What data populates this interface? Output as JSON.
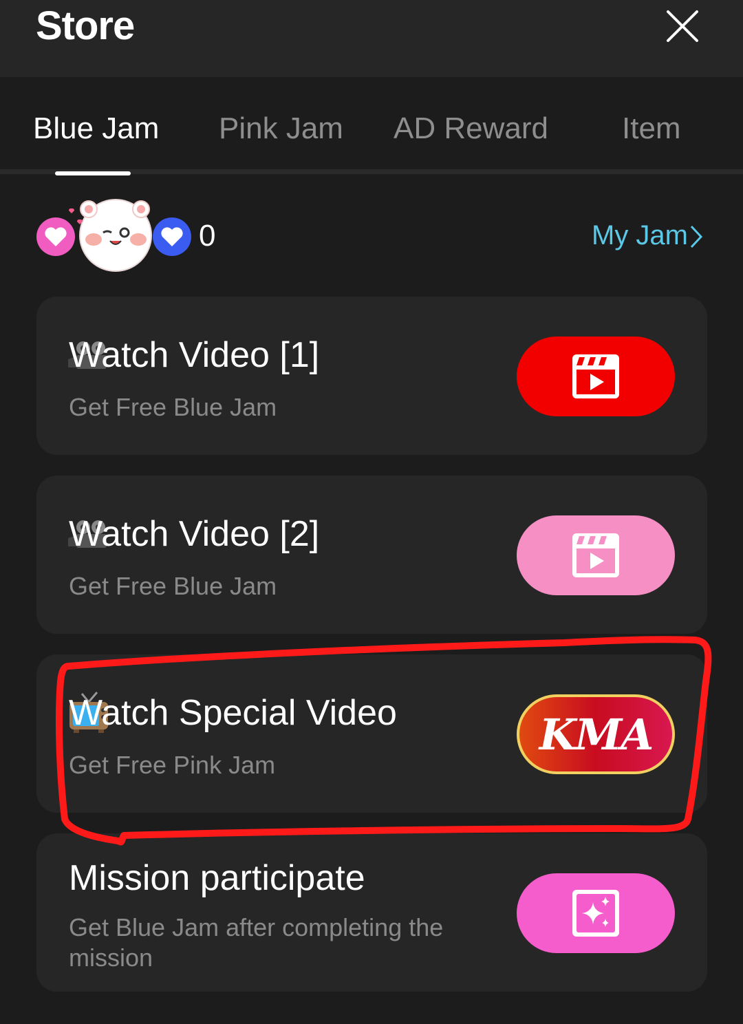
{
  "header": {
    "title": "Store"
  },
  "tabs": [
    {
      "label": "Blue Jam",
      "active": true
    },
    {
      "label": "Pink Jam",
      "active": false
    },
    {
      "label": "AD Reward",
      "active": false
    },
    {
      "label": "Item",
      "active": false
    }
  ],
  "jam": {
    "count": "0",
    "my_jam_label": "My Jam"
  },
  "cards": [
    {
      "title": "Watch Video [1]",
      "subtitle": "Get Free Blue Jam",
      "icon": "movie-camera-icon",
      "button_icon": "video-play-icon",
      "button_color": "#f20000"
    },
    {
      "title": "Watch Video [2]",
      "subtitle": "Get Free Blue Jam",
      "icon": "movie-camera-icon",
      "button_icon": "video-play-icon",
      "button_color": "#f58fc4"
    },
    {
      "title": "Watch Special Video",
      "subtitle": "Get Free Pink Jam",
      "icon": "television-icon",
      "button_label": "KMA",
      "button_color": "#e02040"
    },
    {
      "title": "Mission participate",
      "subtitle": "Get Blue Jam after completing the mission",
      "button_icon": "sparkle-icon",
      "button_color": "#f55ccc"
    }
  ],
  "colors": {
    "background": "#1c1c1c",
    "card": "#262626",
    "accent_link": "#5cc8e8",
    "highlight": "#ff1a1a"
  }
}
